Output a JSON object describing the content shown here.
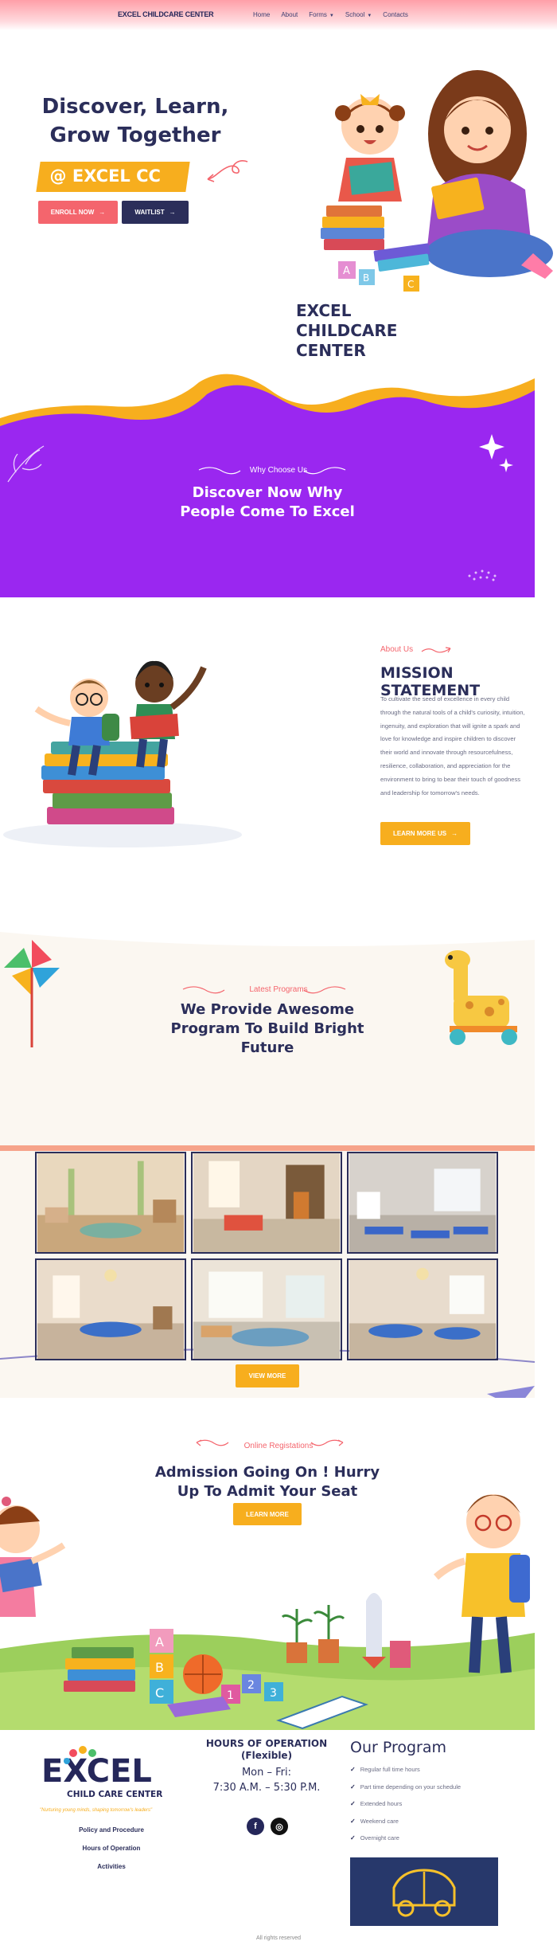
{
  "header": {
    "brand": "EXCEL CHILDCARE CENTER",
    "nav": [
      {
        "label": "Home",
        "has_caret": false
      },
      {
        "label": "About",
        "has_caret": false
      },
      {
        "label": "Forms",
        "has_caret": true
      },
      {
        "label": "School",
        "has_caret": true
      },
      {
        "label": "Contacts",
        "has_caret": false
      }
    ]
  },
  "hero": {
    "title": "Discover, Learn, Grow Together",
    "tag": "@ EXCEL CC",
    "enroll_label": "ENROLL NOW",
    "waitlist_label": "WAITLIST",
    "center_name": "EXCEL CHILDCARE CENTER"
  },
  "why": {
    "kicker": "Why Choose Us",
    "title": "Discover Now Why People Come To Excel"
  },
  "mission": {
    "kicker": "About Us",
    "title": "MISSION STATEMENT",
    "text": "To cultivate the seed of excellence in every child through the natural tools of a child's curiosity, intuition, ingenuity, and exploration that will ignite a spark and love for knowledge and inspire children to discover their world and innovate through resourcefulness, resilience, collaboration, and appreciation for the environment to bring to bear their touch of goodness and leadership for tomorrow's needs.",
    "button_label": "LEARN MORE US"
  },
  "programs": {
    "kicker": "Latest Programs",
    "title": "We Provide Awesome Program To Build Bright Future",
    "button_label": "VIEW MORE"
  },
  "admission": {
    "kicker": "Online Registations",
    "title": "Admission Going On ! Hurry Up To Admit Your Seat",
    "button_label": "LEARN MORE"
  },
  "footer": {
    "logo_word": "EXCEL",
    "logo_sub": "CHILD CARE CENTER",
    "tagline": "\"Nurturing young minds, shaping tomorrow's leaders\"",
    "links": [
      "Policy and Procedure",
      "Hours of Operation",
      "Activities"
    ],
    "hours_title": "HOURS OF OPERATION (Flexible)",
    "hours_days": "Mon – Fri:",
    "hours_time": "7:30 A.M. – 5:30 P.M.",
    "program_title": "Our Program",
    "program_items": [
      "Regular full time hours",
      "Part time depending on your schedule",
      "Extended hours",
      "Weekend care",
      "Overnight care"
    ],
    "rights": "All rights reserved"
  },
  "colors": {
    "navy": "#2b2e5a",
    "coral": "#f4656d",
    "yellow": "#f7ae1e",
    "purple": "#9a27f0"
  }
}
